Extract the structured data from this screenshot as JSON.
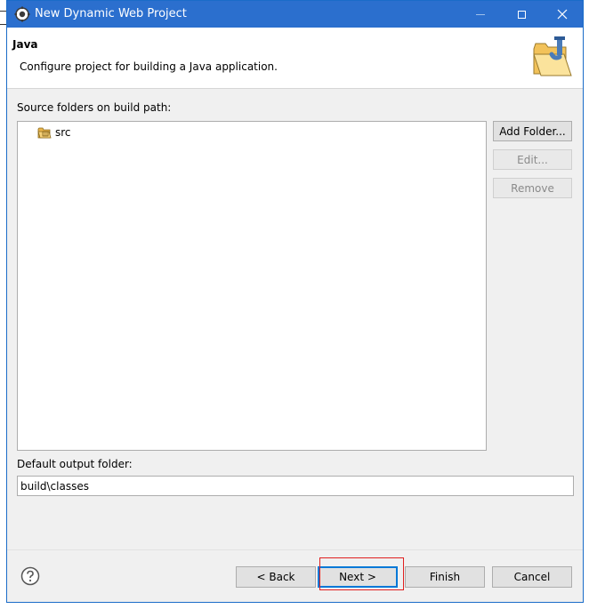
{
  "window": {
    "title": "New Dynamic Web Project"
  },
  "header": {
    "heading": "Java",
    "description": "Configure project for building a Java application."
  },
  "source": {
    "label": "Source folders on build path:",
    "items": [
      {
        "name": "src",
        "icon": "source-folder-icon"
      }
    ]
  },
  "side_buttons": {
    "add": "Add Folder...",
    "edit": "Edit...",
    "remove": "Remove"
  },
  "output": {
    "label": "Default output folder:",
    "value": "build\\classes"
  },
  "footer": {
    "back": "< Back",
    "next": "Next >",
    "finish": "Finish",
    "cancel": "Cancel"
  },
  "colors": {
    "titlebar": "#2b6fce",
    "highlight": "#e02020",
    "default_button_border": "#0078d7"
  }
}
